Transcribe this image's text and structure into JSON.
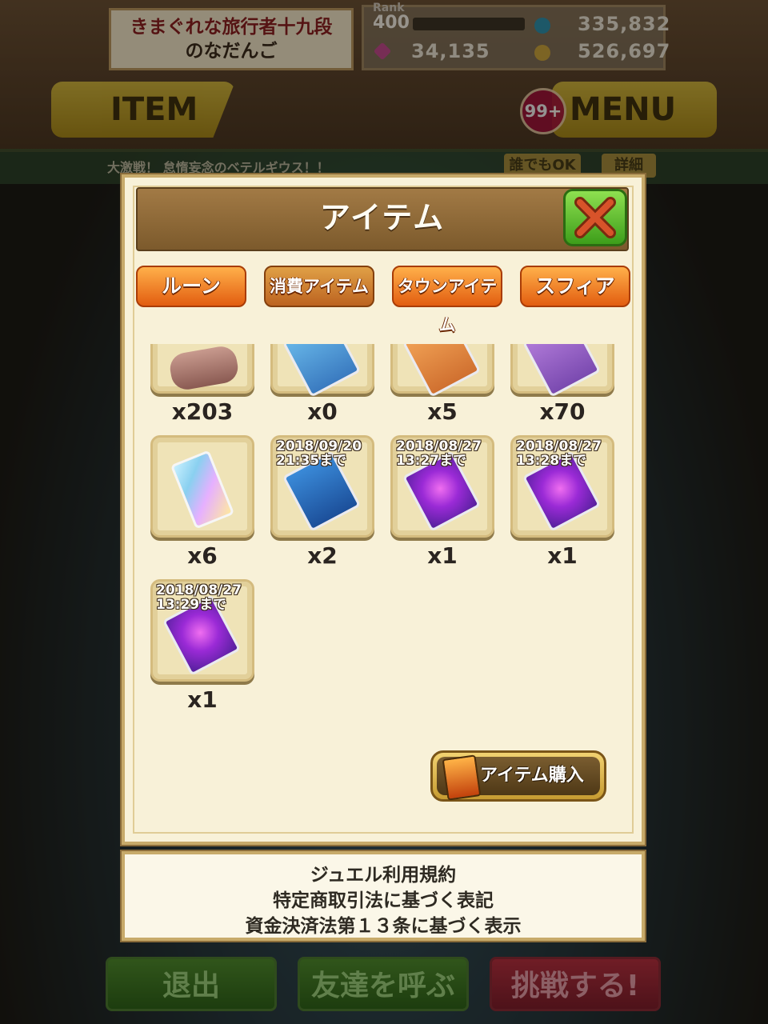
{
  "header": {
    "player_title": "きまぐれな旅行者十九段",
    "player_name": "のなだんご",
    "rank_label": "Rank",
    "rank_value": "400",
    "gems": "34,135",
    "currency_top": "335,832",
    "coins": "526,697",
    "item_button": "ITEM",
    "menu_button": "MENU",
    "menu_badge": "99+"
  },
  "event_bar": {
    "text": "大激戦！ 怠惰妄念のベテルギウス！！",
    "pill_anyone": "誰でもOK",
    "pill_detail": "詳細"
  },
  "panel": {
    "title": "アイテム",
    "tabs": [
      {
        "label": "ルーン",
        "active": false
      },
      {
        "label": "消費アイテム",
        "active": true
      },
      {
        "label": "タウンアイテム",
        "active": false
      },
      {
        "label": "スフィア",
        "active": false
      }
    ],
    "items": [
      {
        "icon": "scroll-icon",
        "qty": "x203",
        "expiry": ""
      },
      {
        "icon": "blue-book-icon",
        "qty": "x0",
        "expiry": ""
      },
      {
        "icon": "orange-book-icon",
        "qty": "x5",
        "expiry": ""
      },
      {
        "icon": "violet-book-icon",
        "qty": "x70",
        "expiry": ""
      },
      {
        "icon": "crystal-ticket-icon",
        "qty": "x6",
        "expiry": ""
      },
      {
        "icon": "blue-book-icon",
        "qty": "x2",
        "expiry_date": "2018/09/20",
        "expiry_time": "21:35まで"
      },
      {
        "icon": "purple-book-icon",
        "qty": "x1",
        "expiry_date": "2018/08/27",
        "expiry_time": "13:27まで"
      },
      {
        "icon": "purple-book-icon",
        "qty": "x1",
        "expiry_date": "2018/08/27",
        "expiry_time": "13:28まで"
      },
      {
        "icon": "purple-book-icon",
        "qty": "x1",
        "expiry_date": "2018/08/27",
        "expiry_time": "13:29まで"
      }
    ],
    "buy_button": "アイテム購入"
  },
  "terms": {
    "line1": "ジュエル利用規約",
    "line2": "特定商取引法に基づく表記",
    "line3": "資金決済法第１３条に基づく表示"
  },
  "bottom": {
    "exit": "退出",
    "call_friends": "友達を呼ぶ",
    "challenge": "挑戦する!"
  },
  "colors": {
    "tab_orange": "#e25d10",
    "close_green": "#3d9e1a",
    "panel_bg": "#f8f1d8"
  }
}
